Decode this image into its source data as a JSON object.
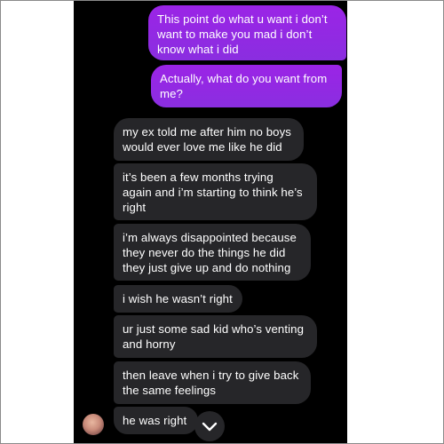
{
  "conversation": {
    "sent": [
      {
        "text": "This point do what u want i don’t\nwant to make you mad i don’t\nknow what i did"
      },
      {
        "text": "Actually, what do you want from\nme?"
      }
    ],
    "received": [
      {
        "text": "my ex told me after him no boys\nwould ever love me like he did"
      },
      {
        "text": "it’s been a few months trying\nagain and i’m starting to think he’s\nright"
      },
      {
        "text": "i’m always disappointed because\nthey never do the things he did\nthey just give up and do nothing"
      },
      {
        "text": "i wish he wasn’t right"
      },
      {
        "text": "ur just some sad kid who’s venting\nand horny"
      },
      {
        "text": "then leave when i try to give back\nthe same feelings"
      },
      {
        "text": "he was right"
      }
    ]
  },
  "colors": {
    "sent_bubble": "#8b2be2",
    "received_bubble": "#262629",
    "background": "#000000"
  },
  "icons": {
    "scroll_down": "chevron-down-icon",
    "avatar": "avatar"
  }
}
